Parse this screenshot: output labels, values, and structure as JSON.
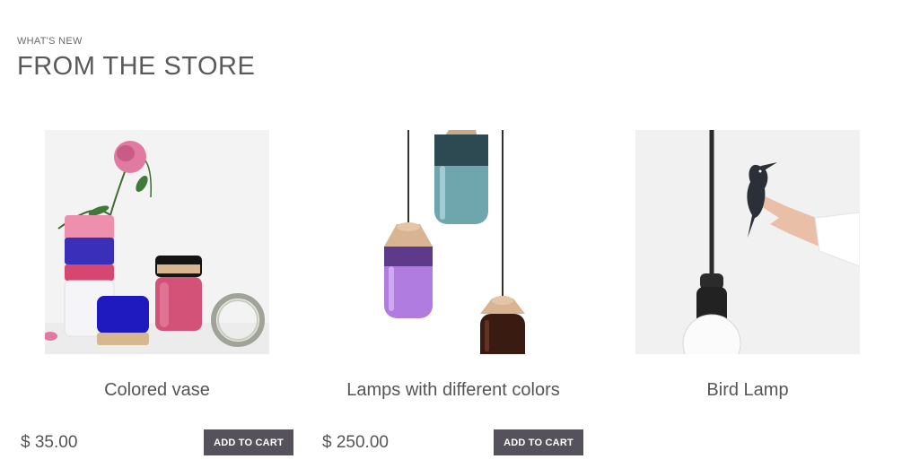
{
  "section": {
    "eyebrow": "WHAT'S NEW",
    "title": "FROM THE STORE"
  },
  "products": [
    {
      "name": "Colored vase",
      "price": "$ 35.00",
      "cta": "ADD TO CART"
    },
    {
      "name": "Lamps with different colors",
      "price": "$ 250.00",
      "cta": "ADD TO CART"
    },
    {
      "name": "Bird Lamp"
    }
  ],
  "colors": {
    "button_bg": "#55525c",
    "heading": "#5a5a5a"
  }
}
